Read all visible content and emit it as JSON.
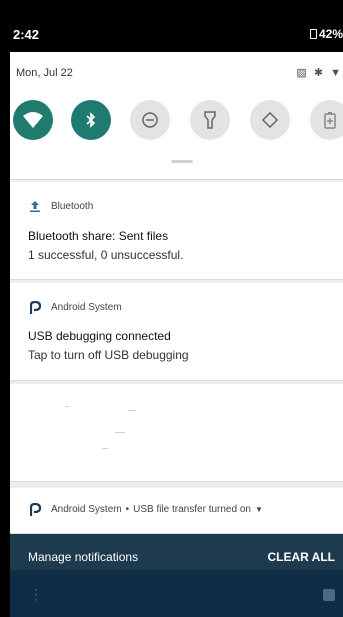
{
  "status_bar": {
    "time": "2:42",
    "battery": "42%"
  },
  "quick_settings": {
    "date": "Mon, Jul 22",
    "tiles": [
      {
        "name": "wifi",
        "active": true
      },
      {
        "name": "bluetooth",
        "active": true
      },
      {
        "name": "do-not-disturb",
        "active": false
      },
      {
        "name": "flashlight",
        "active": false
      },
      {
        "name": "auto-rotate",
        "active": false
      },
      {
        "name": "battery-saver",
        "active": false
      }
    ]
  },
  "notifications": [
    {
      "app": "Bluetooth",
      "title": "Bluetooth share: Sent files",
      "body": "1 successful, 0 unsuccessful."
    },
    {
      "app": "Android System",
      "title": "USB debugging connected",
      "body": "Tap to turn off USB debugging"
    },
    {
      "app": "Android System",
      "summary": "USB file transfer turned on",
      "separator": "•"
    }
  ],
  "footer": {
    "manage_label": "Manage notifications",
    "clear_label": "CLEAR ALL"
  },
  "colors": {
    "accent": "#1f7a6f",
    "footer_bg": "#1d3a4f",
    "nav_bg": "#0f2e45"
  }
}
